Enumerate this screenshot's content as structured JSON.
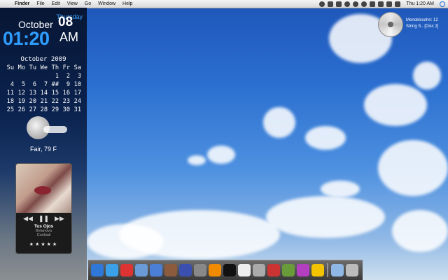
{
  "menubar": {
    "apple": "",
    "items": [
      "Finder",
      "File",
      "Edit",
      "View",
      "Go",
      "Window",
      "Help"
    ],
    "clock": "Thu 1:20 AM"
  },
  "datewidget": {
    "day": "Thursday",
    "month": "October",
    "date": "08",
    "time": "01:20",
    "ampm": "AM"
  },
  "calendar": {
    "title": "October 2009",
    "headers": [
      "Su",
      "Mo",
      "Tu",
      "We",
      "Th",
      "Fr",
      "Sa"
    ],
    "cells": [
      "",
      "",
      "",
      "",
      "1",
      "2",
      "3",
      "4",
      "5",
      "6",
      "7",
      "##",
      "9",
      "10",
      "11",
      "12",
      "13",
      "14",
      "15",
      "16",
      "17",
      "18",
      "19",
      "20",
      "21",
      "22",
      "23",
      "24",
      "25",
      "26",
      "27",
      "28",
      "29",
      "30",
      "31"
    ]
  },
  "weather": {
    "text": "Fair, 79 F"
  },
  "music": {
    "track": "Tus Ojos",
    "artist": "Belanova",
    "album": "Cocktail",
    "prev": "◀◀",
    "pause": "❚❚",
    "next": "▶▶",
    "stars": "★★★★★"
  },
  "nowplaying": {
    "title": "Mendelssohn: 12",
    "subtitle": "String S.. [Disc 2]"
  },
  "dock": {
    "items": [
      {
        "name": "finder-icon",
        "color": "#2f78d8"
      },
      {
        "name": "safari-icon",
        "color": "#3aa0e8"
      },
      {
        "name": "ical-icon",
        "color": "#d33"
      },
      {
        "name": "iphoto-icon",
        "color": "#6a9bd8"
      },
      {
        "name": "itunes-icon",
        "color": "#4b7fd6"
      },
      {
        "name": "guitar-icon",
        "color": "#8c5a3c"
      },
      {
        "name": "globe-icon",
        "color": "#3a4fb0"
      },
      {
        "name": "disk-utility-icon",
        "color": "#888"
      },
      {
        "name": "vlc-icon",
        "color": "#f08a00"
      },
      {
        "name": "terminal-icon",
        "color": "#111"
      },
      {
        "name": "textedit-icon",
        "color": "#eee"
      },
      {
        "name": "calculator-icon",
        "color": "#aaa"
      },
      {
        "name": "color-wheel-icon",
        "color": "#c33"
      },
      {
        "name": "xcode-icon",
        "color": "#6a9b3a"
      },
      {
        "name": "photo-booth-icon",
        "color": "#b43ec0"
      },
      {
        "name": "adium-duck-icon",
        "color": "#f3c200"
      },
      {
        "name": "downloads-folder-icon",
        "color": "#8fb8e6"
      },
      {
        "name": "trash-icon",
        "color": "#bbb"
      }
    ]
  }
}
